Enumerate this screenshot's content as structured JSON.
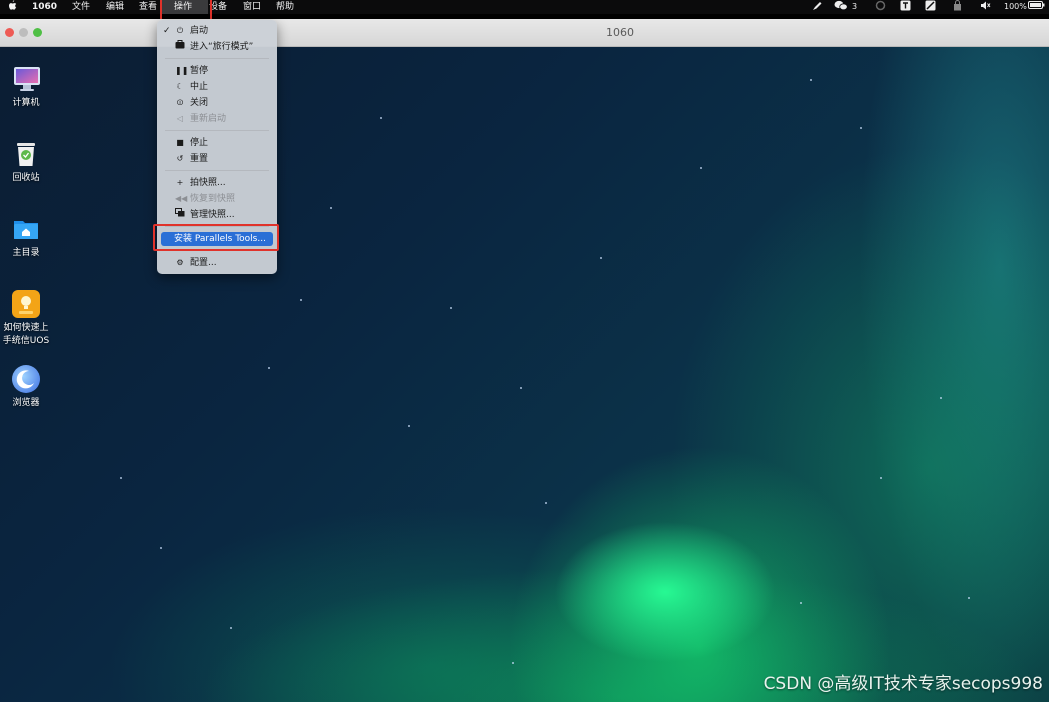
{
  "menubar": {
    "app_name": "1060",
    "menus": [
      "文件",
      "编辑",
      "查看",
      "操作",
      "设备",
      "窗口",
      "帮助"
    ],
    "status": {
      "wechat_count": "3",
      "battery": "100%"
    }
  },
  "window": {
    "title": "1060"
  },
  "dropdown": {
    "items": [
      {
        "label": "启动",
        "icon": "power-icon",
        "checked": true,
        "enabled": true
      },
      {
        "label": "进入“旅行模式”",
        "icon": "suitcase-icon",
        "enabled": true
      },
      {
        "label": "暂停",
        "icon": "pause-icon",
        "enabled": true
      },
      {
        "label": "中止",
        "icon": "moon-icon",
        "enabled": true
      },
      {
        "label": "关闭",
        "icon": "power-off-icon",
        "enabled": true
      },
      {
        "label": "重新启动",
        "icon": "restart-icon",
        "enabled": false
      },
      {
        "label": "停止",
        "icon": "stop-icon",
        "enabled": true
      },
      {
        "label": "重置",
        "icon": "reset-icon",
        "enabled": true
      },
      {
        "label": "拍快照...",
        "icon": "plus-icon",
        "enabled": true
      },
      {
        "label": "恢复到快照",
        "icon": "rewind-icon",
        "enabled": false
      },
      {
        "label": "管理快照...",
        "icon": "snapshots-icon",
        "enabled": true
      },
      {
        "label": "安装 Parallels Tools...",
        "icon": "",
        "enabled": true,
        "selected": true
      },
      {
        "label": "配置...",
        "icon": "gear-icon",
        "enabled": true
      }
    ]
  },
  "desktop": {
    "icons": [
      {
        "label": "计算机",
        "icon": "computer-icon"
      },
      {
        "label": "回收站",
        "icon": "trash-icon"
      },
      {
        "label": "主目录",
        "icon": "home-folder-icon"
      },
      {
        "label": "如何快速上手统信UOS",
        "line1": "如何快速上",
        "line2": "手统信UOS",
        "icon": "help-bulb-icon"
      },
      {
        "label": "浏览器",
        "icon": "browser-icon"
      }
    ]
  },
  "watermark": "CSDN @高级IT技术专家secops998",
  "colors": {
    "highlight_box": "#e0322a",
    "menu_selection": "#2a6fd6",
    "aurora_green": "#28ff96"
  }
}
